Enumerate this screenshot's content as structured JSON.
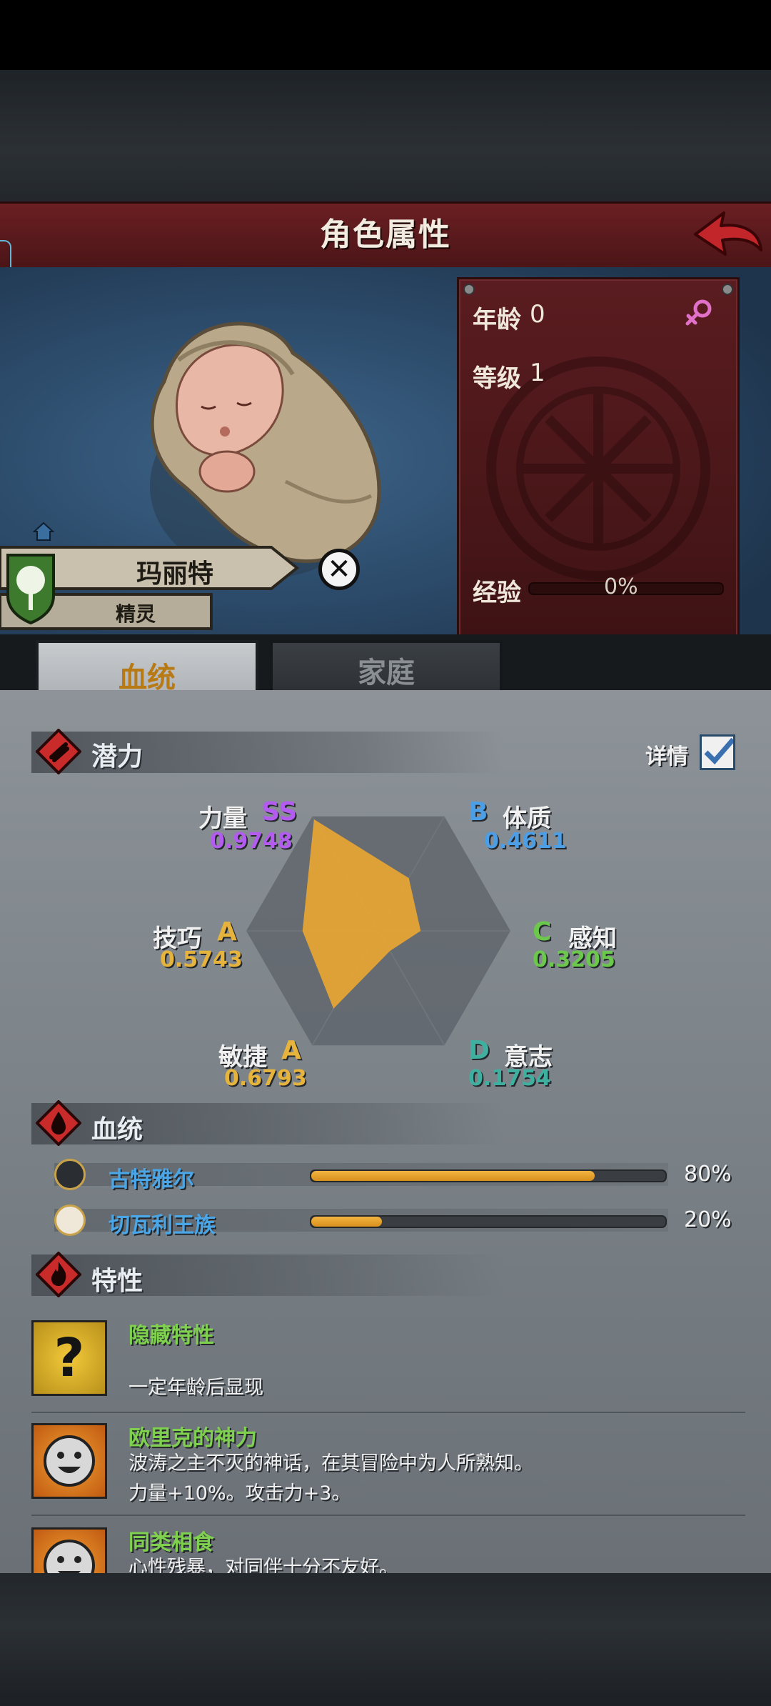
{
  "header": {
    "title": "角色属性"
  },
  "info": {
    "age_label": "年龄",
    "age_value": "0",
    "level_label": "等级",
    "level_value": "1",
    "exp_label": "经验",
    "exp_value": "0%",
    "exp_fraction": 0
  },
  "character": {
    "name": "玛丽特",
    "race": "精灵"
  },
  "tabs": [
    {
      "label": "血统",
      "active": true
    },
    {
      "label": "家庭",
      "active": false
    }
  ],
  "potential": {
    "title": "潜力",
    "detail_label": "详情",
    "detail_checked": true,
    "stats": [
      {
        "name": "力量",
        "grade": "SS",
        "value": "0.9748",
        "color": "#b45cf0"
      },
      {
        "name": "体质",
        "grade": "B",
        "value": "0.4611",
        "color": "#4c9ee6"
      },
      {
        "name": "感知",
        "grade": "C",
        "value": "0.3205",
        "color": "#6cc84c"
      },
      {
        "name": "意志",
        "grade": "D",
        "value": "0.1754",
        "color": "#3fb0a0"
      },
      {
        "name": "敏捷",
        "grade": "A",
        "value": "0.6793",
        "color": "#e6b43c"
      },
      {
        "name": "技巧",
        "grade": "A",
        "value": "0.5743",
        "color": "#e6b43c"
      }
    ]
  },
  "bloodline": {
    "title": "血统",
    "items": [
      {
        "name": "古特雅尔",
        "percent": "80%",
        "fraction": 0.8
      },
      {
        "name": "切瓦利王族",
        "percent": "20%",
        "fraction": 0.2
      }
    ]
  },
  "traits": {
    "title": "特性",
    "items": [
      {
        "title": "隐藏特性",
        "desc1": "",
        "desc2": "一定年龄后显现",
        "icon": "question-mark-icon"
      },
      {
        "title": "欧里克的神力",
        "desc1": "波涛之主不灭的神话，在其冒险中为人所熟知。",
        "desc2": "力量+10%。攻击力+3。",
        "icon": "smiley-face-icon"
      },
      {
        "title": "同类相食",
        "desc1": "心性残暴，对同伴十分不友好。",
        "desc2": "",
        "icon": "smiley-face-icon"
      }
    ]
  },
  "colors": {
    "accent_gold": "#e0a23a",
    "banner_red": "#5a1a1d",
    "trait_green": "#7ed04e"
  }
}
